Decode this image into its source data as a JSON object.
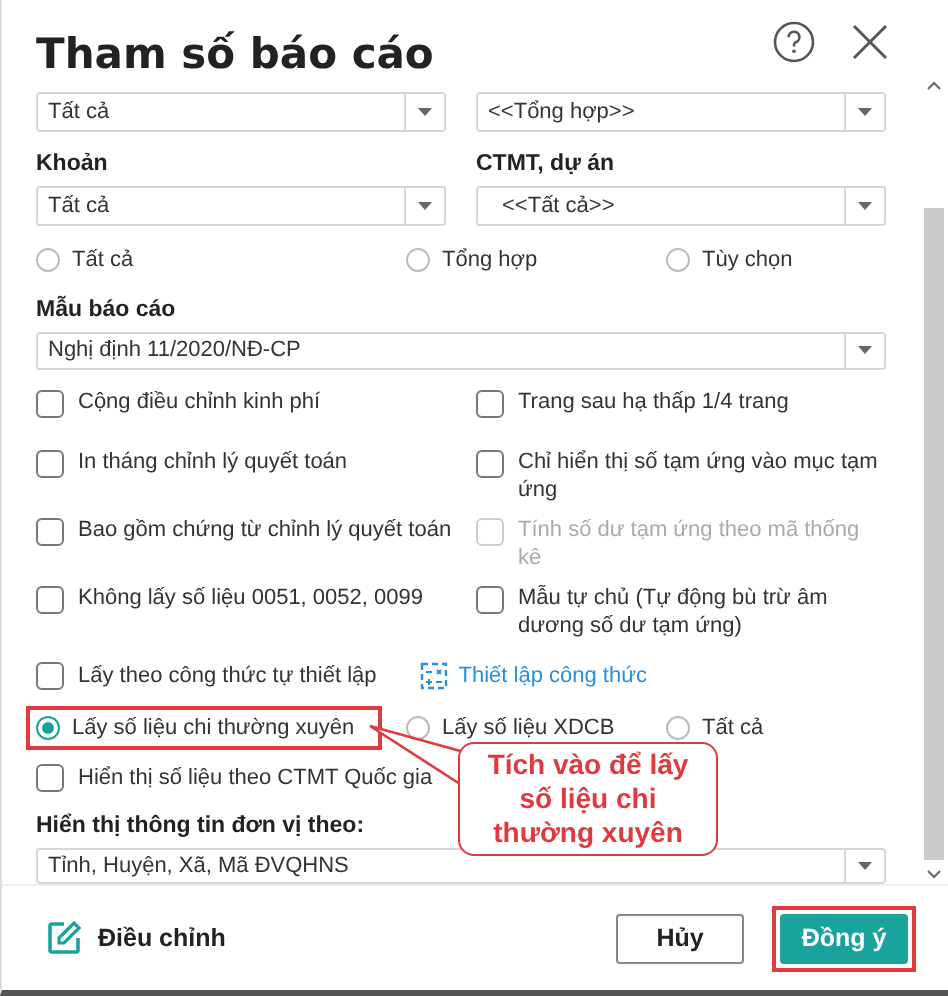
{
  "title": "Tham số báo cáo",
  "top_dropdowns": [
    {
      "value": "Tất cả"
    },
    {
      "value": "<<Tổng hợp>>"
    }
  ],
  "fields": [
    {
      "label": "Khoản",
      "value": "Tất cả"
    },
    {
      "label": "CTMT, dự án",
      "value": "<<Tất cả>>"
    }
  ],
  "scope_radios": [
    {
      "label": "Tất cả",
      "selected": false
    },
    {
      "label": "Tổng hợp",
      "selected": false
    },
    {
      "label": "Tùy chọn",
      "selected": false
    }
  ],
  "template": {
    "label": "Mẫu báo cáo",
    "value": "Nghị định 11/2020/NĐ-CP"
  },
  "options": [
    {
      "label": "Cộng điều chỉnh kinh phí",
      "checked": false,
      "disabled": false
    },
    {
      "label": "Trang sau hạ thấp 1/4 trang",
      "checked": false,
      "disabled": false
    },
    {
      "label": "In tháng chỉnh lý quyết toán",
      "checked": false,
      "disabled": false
    },
    {
      "label": "Chỉ hiển thị số tạm ứng vào mục tạm ứng",
      "checked": false,
      "disabled": false
    },
    {
      "label": "Bao gồm chứng từ chỉnh lý quyết toán",
      "checked": false,
      "disabled": false
    },
    {
      "label": "Tính số dư tạm ứng theo mã thống kê",
      "checked": false,
      "disabled": true
    },
    {
      "label": "Không lấy số liệu 0051, 0052, 0099",
      "checked": false,
      "disabled": false
    },
    {
      "label": "Mẫu tự chủ (Tự động bù trừ âm dương số dư tạm ứng)",
      "checked": false,
      "disabled": false
    }
  ],
  "formula": {
    "label": "Lấy theo công thức tự thiết lập",
    "checked": false,
    "link": "Thiết lập công thức"
  },
  "data_radios": [
    {
      "label": "Lấy số liệu chi thường xuyên",
      "selected": true,
      "highlighted": true
    },
    {
      "label": "Lấy số liệu XDCB",
      "selected": false,
      "highlighted": false
    },
    {
      "label": "Tất cả",
      "selected": false,
      "highlighted": false
    }
  ],
  "national": {
    "label": "Hiển thị số liệu theo CTMT Quốc gia",
    "checked": false
  },
  "unit_display": {
    "label": "Hiển thị thông tin đơn vị theo:",
    "value": "Tỉnh, Huyện, Xã, Mã ĐVQHNS"
  },
  "callout": "Tích vào để lấy số liệu chi thường xuyên",
  "footer": {
    "edit": "Điều chỉnh",
    "buttons": [
      {
        "label": "Hủy",
        "kind": "secondary",
        "highlighted": false
      },
      {
        "label": "Đồng ý",
        "kind": "primary",
        "highlighted": true
      }
    ]
  }
}
